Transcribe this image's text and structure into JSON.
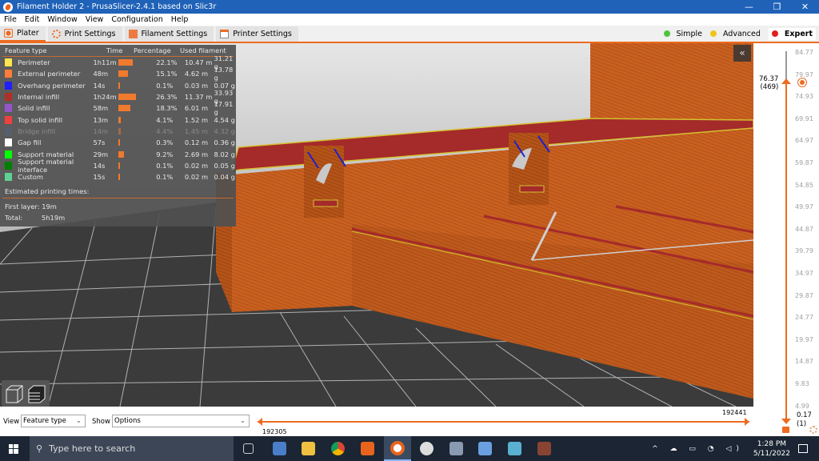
{
  "window": {
    "title": "Filament Holder 2 - PrusaSlicer-2.4.1 based on Slic3r",
    "minimize": "—",
    "maximize": "❐",
    "close": "✕"
  },
  "menu": [
    "File",
    "Edit",
    "Window",
    "View",
    "Configuration",
    "Help"
  ],
  "tabs": [
    {
      "label": "Plater",
      "active": true
    },
    {
      "label": "Print Settings"
    },
    {
      "label": "Filament Settings"
    },
    {
      "label": "Printer Settings"
    }
  ],
  "modes": [
    {
      "label": "Simple",
      "color": "#4fc43a"
    },
    {
      "label": "Advanced",
      "color": "#f0c419"
    },
    {
      "label": "Expert",
      "color": "#e0201a",
      "active": true
    }
  ],
  "legend": {
    "headers": [
      "Feature type",
      "Time",
      "Percentage",
      "Used filament"
    ],
    "rows": [
      {
        "name": "Perimeter",
        "color": "#ffe64d",
        "time": "1h11m",
        "pct": "22.1%",
        "pctval": 22.1,
        "len": "10.47 m",
        "wt": "31.21 g"
      },
      {
        "name": "External perimeter",
        "color": "#ff7d38",
        "time": "48m",
        "pct": "15.1%",
        "pctval": 15.1,
        "len": "4.62 m",
        "wt": "13.78 g"
      },
      {
        "name": "Overhang perimeter",
        "color": "#1f1fff",
        "time": "14s",
        "pct": "0.1%",
        "pctval": 0.1,
        "len": "0.03 m",
        "wt": "0.07 g"
      },
      {
        "name": "Internal infill",
        "color": "#b03029",
        "time": "1h24m",
        "pct": "26.3%",
        "pctval": 26.3,
        "len": "11.37 m",
        "wt": "33.93 g"
      },
      {
        "name": "Solid infill",
        "color": "#9654cc",
        "time": "58m",
        "pct": "18.3%",
        "pctval": 18.3,
        "len": "6.01 m",
        "wt": "17.91 g"
      },
      {
        "name": "Top solid infill",
        "color": "#f04040",
        "time": "13m",
        "pct": "4.1%",
        "pctval": 4.1,
        "len": "1.52 m",
        "wt": "4.54 g"
      },
      {
        "name": "Bridge infill",
        "color": "#4d6680",
        "time": "14m",
        "pct": "4.4%",
        "pctval": 4.4,
        "len": "1.45 m",
        "wt": "4.32 g",
        "disabled": true
      },
      {
        "name": "Gap fill",
        "color": "#ffffff",
        "time": "57s",
        "pct": "0.3%",
        "pctval": 0.3,
        "len": "0.12 m",
        "wt": "0.36 g"
      },
      {
        "name": "Support material",
        "color": "#00ff00",
        "time": "29m",
        "pct": "9.2%",
        "pctval": 9.2,
        "len": "2.69 m",
        "wt": "8.02 g"
      },
      {
        "name": "Support material interface",
        "color": "#008000",
        "time": "14s",
        "pct": "0.1%",
        "pctval": 0.1,
        "len": "0.02 m",
        "wt": "0.05 g"
      },
      {
        "name": "Custom",
        "color": "#5ed194",
        "time": "15s",
        "pct": "0.1%",
        "pctval": 0.1,
        "len": "0.02 m",
        "wt": "0.04 g"
      }
    ],
    "estimated_label": "Estimated printing times:",
    "first_layer_label": "First layer:",
    "first_layer": "19m",
    "total_label": "Total:",
    "total": "5h19m"
  },
  "collapse_icon": "«",
  "vertical_slider": {
    "ticks": [
      "84.77",
      "79.97",
      "74.93",
      "69.91",
      "64.97",
      "59.87",
      "54.85",
      "49.97",
      "44.87",
      "39.79",
      "34.97",
      "29.87",
      "24.77",
      "19.97",
      "14.87",
      "9.83",
      "4.99"
    ],
    "upper_value": "76.37",
    "upper_layer": "(469)",
    "lower_value": "0.17",
    "lower_layer": "(1)"
  },
  "bottom": {
    "view_label": "View",
    "view_value": "Feature type",
    "show_label": "Show",
    "show_value": "Options",
    "h_upper": "192441",
    "h_lower": "192305"
  },
  "taskbar": {
    "search_placeholder": "Type here to search",
    "time": "1:28 PM",
    "date": "5/11/2022"
  }
}
